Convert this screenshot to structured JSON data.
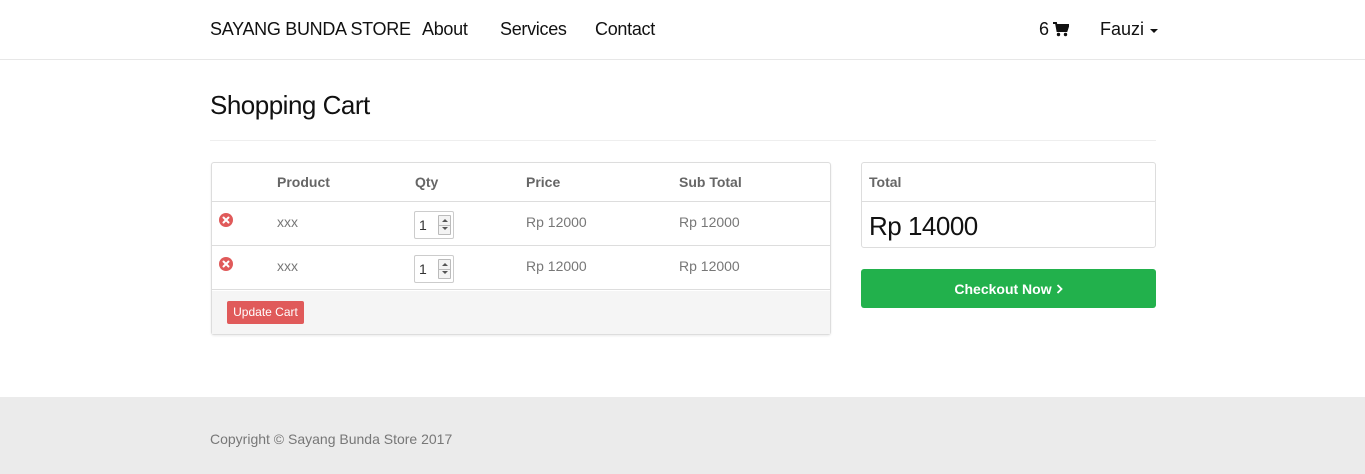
{
  "navbar": {
    "brand": "SAYANG BUNDA STORE",
    "links": [
      "About",
      "Services",
      "Contact"
    ],
    "cart_count": "6",
    "cart_icon": "shopping-cart-icon",
    "user_name": "Fauzi"
  },
  "page": {
    "title": "Shopping Cart"
  },
  "cart": {
    "headers": {
      "product": "Product",
      "qty": "Qty",
      "price": "Price",
      "subtotal": "Sub Total"
    },
    "items": [
      {
        "product": "xxx",
        "qty": "1",
        "price": "Rp 12000",
        "subtotal": "Rp 12000"
      },
      {
        "product": "xxx",
        "qty": "1",
        "price": "Rp 12000",
        "subtotal": "Rp 12000"
      }
    ],
    "update_label": "Update Cart"
  },
  "summary": {
    "total_label": "Total",
    "total_value": "Rp 14000",
    "checkout_label": "Checkout Now",
    "checkout_icon": "chevron-right-icon"
  },
  "footer": {
    "copyright": "Copyright © Sayang Bunda Store 2017"
  },
  "colors": {
    "accent_green": "#22b14c",
    "danger_red": "#e05a5a",
    "footer_bg": "#ebebeb"
  }
}
